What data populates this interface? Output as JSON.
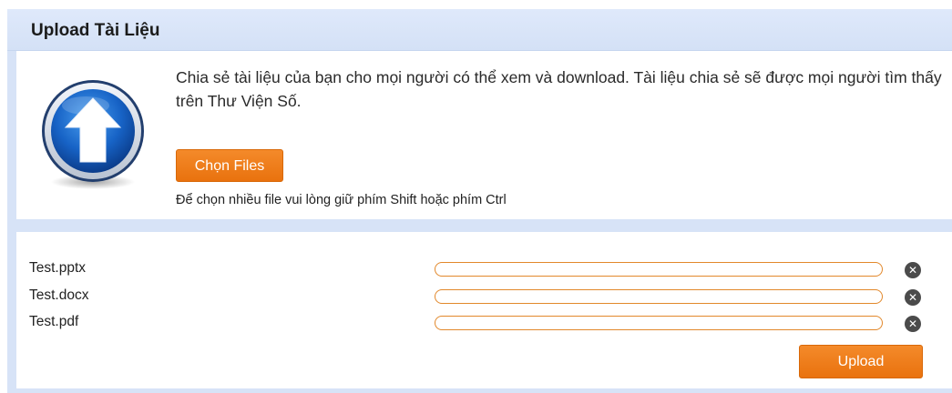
{
  "header": {
    "title": "Upload Tài Liệu"
  },
  "intro": {
    "description": "Chia sẻ tài liệu của bạn cho mọi người có thể xem và download. Tài liệu chia sẻ sẽ được mọi người tìm thấy trên Thư Viện Số.",
    "choose_label": "Chọn Files",
    "hint": "Để chọn nhiều file vui lòng giữ phím Shift hoặc phím Ctrl",
    "icon": "upload-arrow-icon"
  },
  "files": [
    {
      "name": "Test.pptx",
      "progress": 0,
      "remove_icon": "close-icon"
    },
    {
      "name": "Test.docx",
      "progress": 0,
      "remove_icon": "close-icon"
    },
    {
      "name": "Test.pdf",
      "progress": 0,
      "remove_icon": "close-icon"
    }
  ],
  "actions": {
    "upload_label": "Upload"
  },
  "colors": {
    "accent": "#ee7a14",
    "header_bg": "#d7e3f7",
    "progress_border": "#e2882b",
    "remove_icon": "#4b4b4b"
  }
}
